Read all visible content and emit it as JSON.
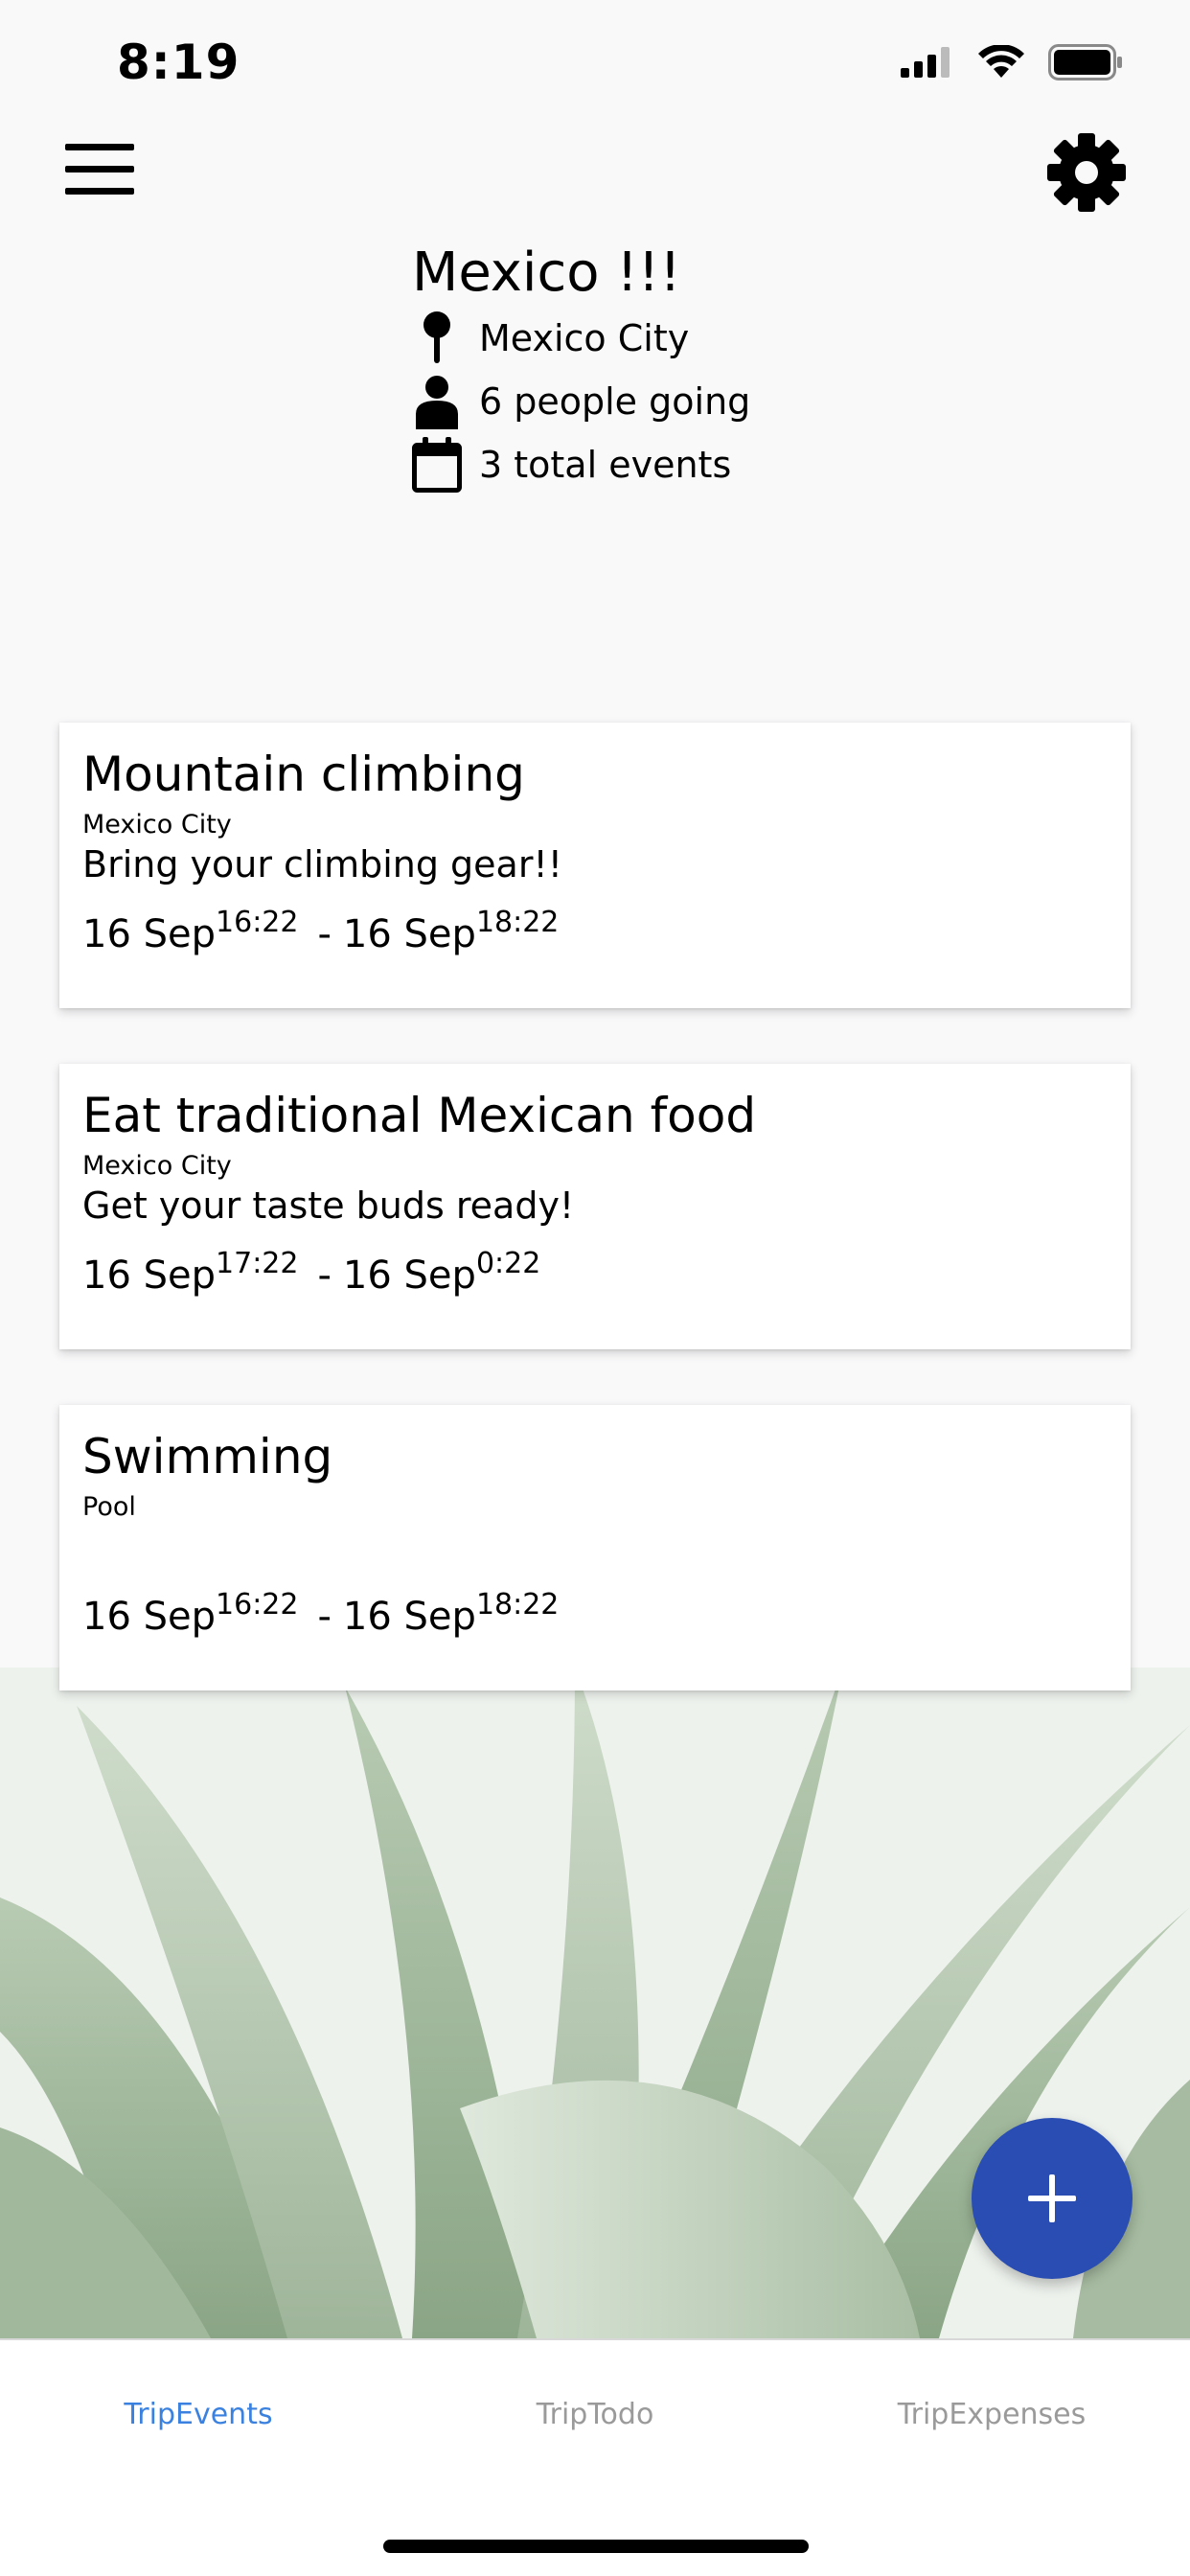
{
  "status_bar": {
    "time": "8:19"
  },
  "header": {
    "menu_icon": "hamburger-menu-icon",
    "settings_icon": "gear-icon"
  },
  "trip": {
    "title": "Mexico !!!",
    "location": "Mexico City",
    "people": "6 people going",
    "events_count": "3 total events"
  },
  "events": [
    {
      "title": "Mountain climbing",
      "location": "Mexico City",
      "description": "Bring your climbing gear!!",
      "start_date": "16 Sep",
      "start_time": "16:22",
      "separator": "-",
      "end_date": "16 Sep",
      "end_time": "18:22"
    },
    {
      "title": "Eat traditional Mexican food",
      "location": "Mexico City",
      "description": "Get your taste buds ready!",
      "start_date": "16 Sep",
      "start_time": "17:22",
      "separator": "-",
      "end_date": "16 Sep",
      "end_time": "0:22"
    },
    {
      "title": "Swimming",
      "location": "Pool",
      "description": "",
      "start_date": "16 Sep",
      "start_time": "16:22",
      "separator": "-",
      "end_date": "16 Sep",
      "end_time": "18:22"
    }
  ],
  "fab": {
    "icon": "plus-icon",
    "color": "#2a4db3"
  },
  "tabs": [
    {
      "label": "TripEvents",
      "active": true
    },
    {
      "label": "TripTodo",
      "active": false
    },
    {
      "label": "TripExpenses",
      "active": false
    }
  ],
  "colors": {
    "accent": "#3b82e0",
    "tab_inactive": "#9a9a9a",
    "background": "#f9f9fa"
  }
}
